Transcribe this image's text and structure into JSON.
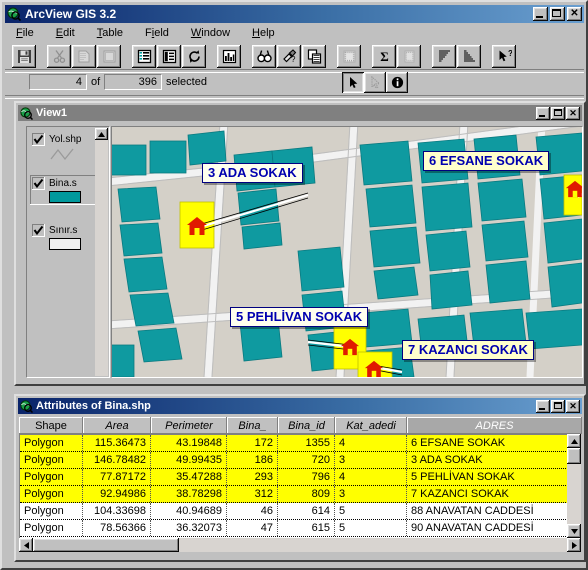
{
  "app": {
    "title": "ArcView GIS 3.2",
    "icon": "arcview-globe-icon",
    "window_buttons": {
      "minimize": "_",
      "maximize": "□",
      "close": "✕"
    }
  },
  "menu": [
    {
      "label": "File",
      "accel": "F"
    },
    {
      "label": "Edit",
      "accel": "E"
    },
    {
      "label": "Table",
      "accel": "T"
    },
    {
      "label": "Field",
      "accel": "i"
    },
    {
      "label": "Window",
      "accel": "W"
    },
    {
      "label": "Help",
      "accel": "H"
    }
  ],
  "toolbar": [
    {
      "name": "save-project-icon",
      "tip": "Save Project"
    },
    {
      "name": "cut-icon",
      "tip": "Cut"
    },
    {
      "name": "copy-icon",
      "tip": "Copy"
    },
    {
      "name": "paste-icon",
      "tip": "Paste"
    },
    {
      "name": "add-table-icon",
      "tip": "Add Table"
    },
    {
      "name": "table-properties-icon",
      "tip": "Table Properties"
    },
    {
      "name": "refresh-icon",
      "tip": "Refresh"
    },
    {
      "name": "create-chart-icon",
      "tip": "Create Chart"
    },
    {
      "name": "find-icon",
      "tip": "Find"
    },
    {
      "name": "query-builder-icon",
      "tip": "Query Builder"
    },
    {
      "name": "join-icon",
      "tip": "Join"
    },
    {
      "name": "link-icon",
      "tip": "Link"
    },
    {
      "name": "sum-icon",
      "tip": "Summarize"
    },
    {
      "name": "calculate-icon",
      "tip": "Calculate"
    },
    {
      "name": "sort-ascending-icon",
      "tip": "Sort Ascending"
    },
    {
      "name": "sort-descending-icon",
      "tip": "Sort Descending"
    },
    {
      "name": "help-pointer-icon",
      "tip": "Help"
    }
  ],
  "status": {
    "selected_count": "4",
    "of_label": "of",
    "total_count": "396",
    "selected_label": "selected"
  },
  "tools": [
    {
      "name": "select-pointer-tool",
      "state": "pressed",
      "icon": "arrow-pointer-icon"
    },
    {
      "name": "select-field-tool",
      "state": "disabled",
      "icon": "arrow-dotted-icon"
    },
    {
      "name": "identify-tool",
      "state": "normal",
      "icon": "info-icon"
    }
  ],
  "view_window": {
    "title": "View1",
    "icon": "arcview-globe-icon",
    "buttons": {
      "minimize": "_",
      "maximize": "□",
      "close": "✕"
    },
    "legend": {
      "layers": [
        {
          "name": "Yol.shp",
          "symbol": "line",
          "color": "#9a9a9a",
          "checked": true,
          "selected": false
        },
        {
          "name": "Bina.s",
          "symbol": "polygon",
          "color": "#00999c",
          "checked": true,
          "selected": true
        },
        {
          "name": "Sınır.s",
          "symbol": "polygon",
          "color": "#f0f0f0",
          "checked": true,
          "selected": false
        }
      ],
      "scroll_up": "▲"
    },
    "map": {
      "background_color": "#d4d0c8",
      "building_color": "#0f9aa0",
      "road_color": "#f5f5f5",
      "highlight_color": "#ffff00",
      "marker": "red-house-icon",
      "callouts": [
        {
          "text": "3 ADA SOKAK",
          "style": "white"
        },
        {
          "text": "6 EFSANE SOKAK",
          "style": "yellow"
        },
        {
          "text": "5 PEHLİVAN SOKAK",
          "style": "white"
        },
        {
          "text": "7 KAZANCI SOKAK",
          "style": "yellow"
        }
      ]
    }
  },
  "table_window": {
    "title": "Attributes of Bina.shp",
    "icon": "arcview-globe-icon",
    "buttons": {
      "minimize": "_",
      "maximize": "□",
      "close": "✕"
    },
    "columns": [
      {
        "label": "Shape",
        "align": "l",
        "width": 64,
        "italic": false,
        "active": false
      },
      {
        "label": "Area",
        "align": "r",
        "width": 68,
        "italic": true,
        "active": false
      },
      {
        "label": "Perimeter",
        "align": "r",
        "width": 76,
        "italic": true,
        "active": false
      },
      {
        "label": "Bina_",
        "align": "r",
        "width": 51,
        "italic": true,
        "active": false
      },
      {
        "label": "Bina_id",
        "align": "r",
        "width": 57,
        "italic": true,
        "active": false
      },
      {
        "label": "Kat_adedi",
        "align": "l",
        "width": 72,
        "italic": true,
        "active": false
      },
      {
        "label": "ADRES",
        "align": "l",
        "width": 172,
        "italic": true,
        "active": true
      }
    ],
    "rows": [
      {
        "selected": true,
        "cells": [
          "Polygon",
          "115.36473",
          "43.19848",
          "172",
          "1355",
          "4",
          "6 EFSANE SOKAK"
        ]
      },
      {
        "selected": true,
        "cells": [
          "Polygon",
          "146.78482",
          "49.99435",
          "186",
          "720",
          "3",
          "3 ADA SOKAK"
        ]
      },
      {
        "selected": true,
        "cells": [
          "Polygon",
          "77.87172",
          "35.47288",
          "293",
          "796",
          "4",
          "5 PEHLİVAN SOKAK"
        ]
      },
      {
        "selected": true,
        "cells": [
          "Polygon",
          "92.94986",
          "38.78298",
          "312",
          "809",
          "3",
          "7 KAZANCI SOKAK"
        ]
      },
      {
        "selected": false,
        "cells": [
          "Polygon",
          "104.33698",
          "40.94689",
          "46",
          "614",
          "5",
          "88 ANAVATAN CADDESİ"
        ]
      },
      {
        "selected": false,
        "cells": [
          "Polygon",
          "78.56366",
          "36.32073",
          "47",
          "615",
          "5",
          "90 ANAVATAN  CADDESİ"
        ]
      }
    ],
    "scroll": {
      "up": "▲",
      "down": "▼",
      "left": "◄",
      "right": "►"
    }
  },
  "colors": {
    "selection_yellow": "#ffff00",
    "building_teal": "#0f9aa0",
    "callout_text": "#0000b0",
    "titlebar_blue": "#0a246a",
    "face": "#c0c0c0"
  }
}
